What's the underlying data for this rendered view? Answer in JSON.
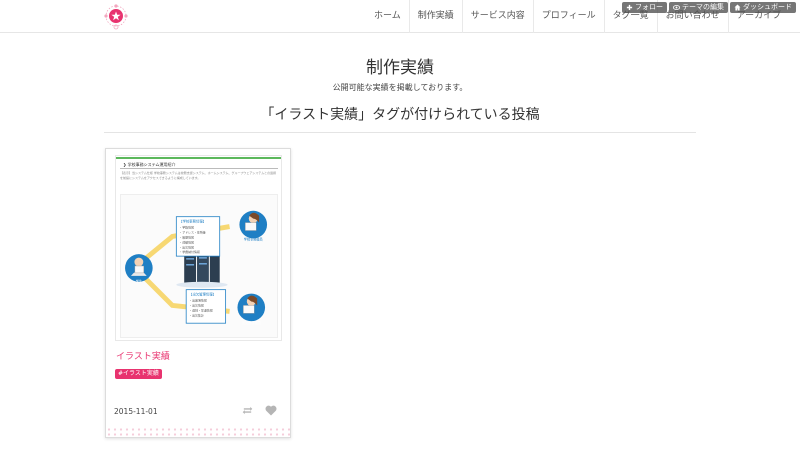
{
  "header": {
    "nav": [
      "ホーム",
      "制作実績",
      "サービス内容",
      "プロフィール",
      "タグ一覧",
      "お問い合わせ",
      "アーカイブ"
    ]
  },
  "controls": {
    "follow": "フォロー",
    "edit_theme": "テーマの編集",
    "dashboard": "ダッシュボード"
  },
  "page": {
    "title": "制作実績",
    "subtitle": "公開可能な実績を掲載しております。",
    "tag_heading": "「イラスト実績」タグが付けられている投稿"
  },
  "post": {
    "thumb_heading": "学校事務システム運用紹介",
    "thumb_text": "【表示】当システム仕様 学校事務システムは校務支援システム、ホームシステム、グループウェアシステムとの連携を前提にシステムをアクセスできるように構成しています。",
    "fig_box1_title": "【学校事務情報】",
    "fig_box1_items": [
      "・学籍情報",
      "・アドレス・住所等",
      "・履歴情報",
      "・成績情報",
      "・出欠情報",
      "・学費納付情報"
    ],
    "fig_box2_title": "【出欠管理情報】",
    "fig_box2_items": [
      "・出席簿情報",
      "・出欠情報",
      "・遅刻・早退情報",
      "・出欠集計"
    ],
    "fig_label_student": "学生",
    "fig_label_staff1": "学校事務職員",
    "fig_label_staff2": "出欠管理職員",
    "title": "イラスト実績",
    "tag": "#イラスト実績",
    "date": "2015-11-01"
  },
  "colors": {
    "accent": "#e8336f",
    "topline": "#5cb85c",
    "diagram_blue": "#1f7fc4"
  }
}
